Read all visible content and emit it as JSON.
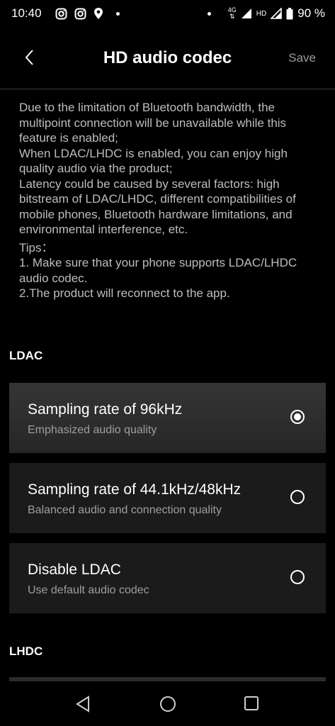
{
  "status_bar": {
    "time": "10:40",
    "left_icons": [
      "instagram-icon",
      "instagram-icon",
      "location-icon"
    ],
    "network": "4G",
    "hd": "HD",
    "battery": "90 %"
  },
  "header": {
    "title": "HD audio codec",
    "save_label": "Save"
  },
  "description": {
    "lines": [
      "Due to the limitation of Bluetooth bandwidth, the multipoint connection will be unavailable while this feature is enabled;",
      "When LDAC/LHDC is enabled, you can enjoy high quality audio via the product;",
      "Latency could be caused by several factors: high bitstream of LDAC/LHDC, different compatibilities of mobile phones, Bluetooth hardware limitations, and environmental interference, etc."
    ],
    "tips_label": "Tips：",
    "tips": [
      "1. Make sure that your phone supports LDAC/LHDC audio codec.",
      "2.The product will reconnect to the app."
    ]
  },
  "ldac": {
    "section_label": "LDAC",
    "options": [
      {
        "title": "Sampling rate of 96kHz",
        "subtitle": "Emphasized audio quality",
        "selected": true
      },
      {
        "title": "Sampling rate of 44.1kHz/48kHz",
        "subtitle": "Balanced audio and connection quality",
        "selected": false
      },
      {
        "title": "Disable LDAC",
        "subtitle": "Use default audio codec",
        "selected": false
      }
    ]
  },
  "lhdc": {
    "section_label": "LHDC"
  },
  "nav_bar": {
    "buttons": [
      "back-triangle-icon",
      "home-circle-icon",
      "recents-square-icon"
    ]
  },
  "colors": {
    "background": "#000000",
    "card": "#1b1b1b",
    "card_selected": "#303030",
    "secondary_text": "#9e9e9e"
  }
}
